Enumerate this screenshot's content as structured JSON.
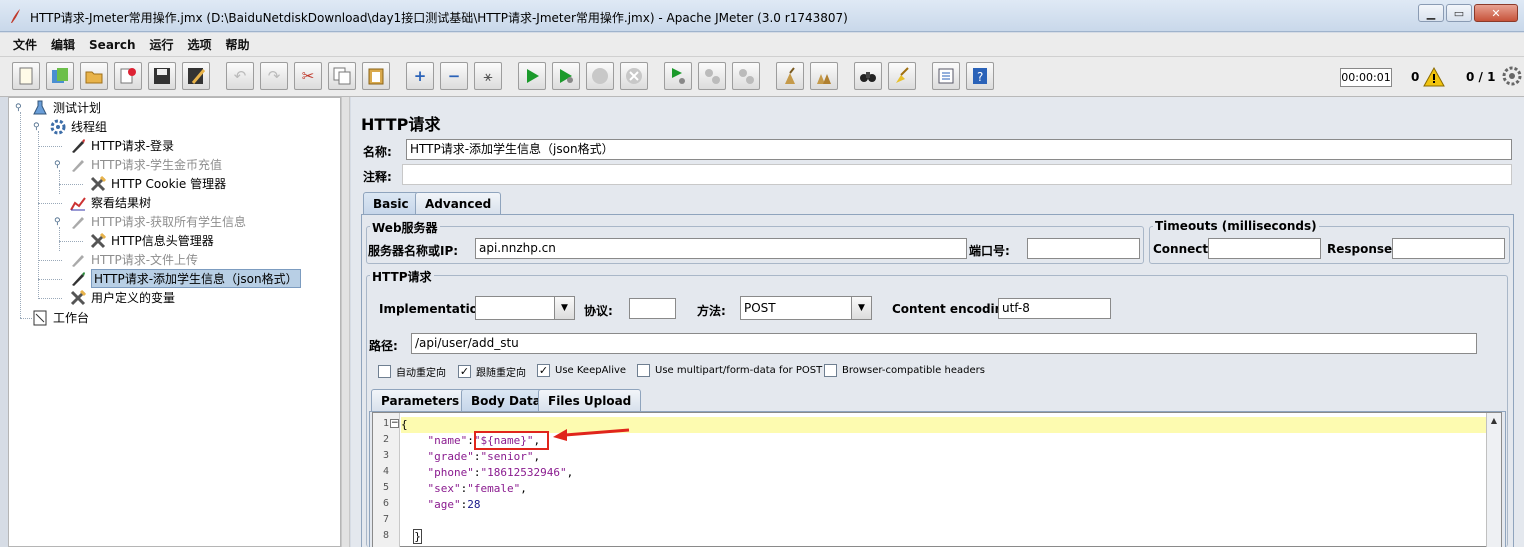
{
  "window": {
    "title": "HTTP请求-Jmeter常用操作.jmx (D:\\BaiduNetdiskDownload\\day1接口测试基础\\HTTP请求-Jmeter常用操作.jmx) - Apache JMeter (3.0 r1743807)",
    "minimize": "▁",
    "maximize": "▭",
    "close": "✕"
  },
  "menu": [
    "文件",
    "编辑",
    "Search",
    "运行",
    "选项",
    "帮助"
  ],
  "toolbar": {
    "timer": "00:00:01",
    "error_count": "0",
    "threads": "0 / 1"
  },
  "tree": [
    {
      "label": "测试计划"
    },
    {
      "label": "线程组"
    },
    {
      "label": "HTTP请求-登录"
    },
    {
      "label": "HTTP请求-学生金币充值"
    },
    {
      "label": "HTTP Cookie 管理器"
    },
    {
      "label": "察看结果树"
    },
    {
      "label": "HTTP请求-获取所有学生信息"
    },
    {
      "label": "HTTP信息头管理器"
    },
    {
      "label": "HTTP请求-文件上传"
    },
    {
      "label": "HTTP请求-添加学生信息（json格式）"
    },
    {
      "label": "用户定义的变量"
    },
    {
      "label": "工作台"
    }
  ],
  "panel": {
    "title": "HTTP请求",
    "name_label": "名称:",
    "name_value": "HTTP请求-添加学生信息（json格式）",
    "comment_label": "注释:",
    "comment_value": "",
    "tabs": [
      "Basic",
      "Advanced"
    ],
    "web_server": {
      "group_title": "Web服务器",
      "server_label": "服务器名称或IP:",
      "server_value": "api.nnzhp.cn",
      "port_label": "端口号:",
      "port_value": ""
    },
    "timeouts": {
      "group_title": "Timeouts (milliseconds)",
      "connect_label": "Connect:",
      "connect_value": "",
      "response_label": "Response:",
      "response_value": ""
    },
    "http_request": {
      "group_title": "HTTP请求",
      "implementation_label": "Implementation:",
      "implementation_value": "",
      "protocol_label": "协议:",
      "protocol_value": "",
      "method_label": "方法:",
      "method_value": "POST",
      "encoding_label": "Content encoding:",
      "encoding_value": "utf-8",
      "path_label": "路径:",
      "path_value": "/api/user/add_stu"
    },
    "checkboxes": [
      {
        "label": "自动重定向",
        "checked": false
      },
      {
        "label": "跟随重定向",
        "checked": true
      },
      {
        "label": "Use KeepAlive",
        "checked": true
      },
      {
        "label": "Use multipart/form-data for POST",
        "checked": false
      },
      {
        "label": "Browser-compatible headers",
        "checked": false
      }
    ],
    "body_tabs": [
      "Parameters",
      "Body Data",
      "Files Upload"
    ],
    "body_lines": [
      {
        "num": "1",
        "text": "{"
      },
      {
        "num": "2",
        "key": "\"name\"",
        "value": "\"${name}\"",
        "tail": ","
      },
      {
        "num": "3",
        "key": "\"grade\"",
        "value": "\"senior\"",
        "tail": ","
      },
      {
        "num": "4",
        "key": "\"phone\"",
        "value": "\"18612532946\"",
        "tail": ","
      },
      {
        "num": "5",
        "key": "\"sex\"",
        "value": "\"female\"",
        "tail": ","
      },
      {
        "num": "6",
        "key": "\"age\"",
        "value": "28",
        "tail": ""
      },
      {
        "num": "7",
        "text": ""
      },
      {
        "num": "8",
        "text": "}"
      }
    ],
    "annotation_color": "#e0251b"
  }
}
